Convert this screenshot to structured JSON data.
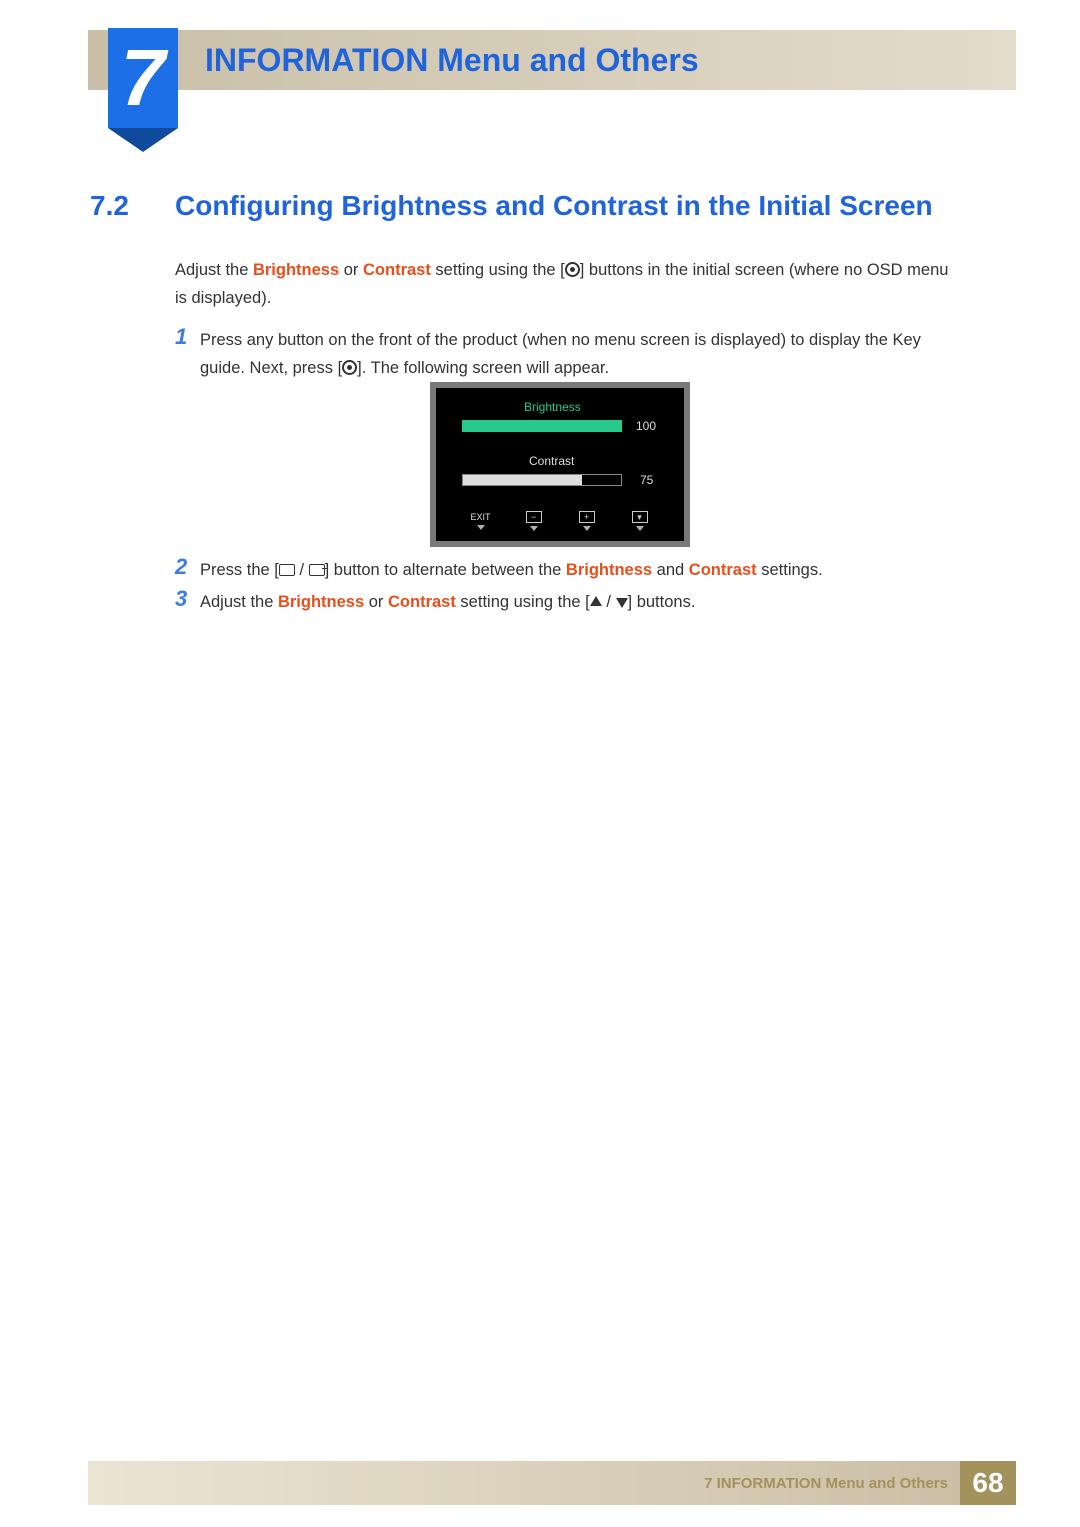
{
  "chapter": {
    "number": "7",
    "title": "INFORMATION Menu and Others"
  },
  "section": {
    "number": "7.2",
    "title": "Configuring Brightness and Contrast in the Initial Screen"
  },
  "intro": {
    "p1a": "Adjust the ",
    "p1b": "Brightness",
    "p1c": " or ",
    "p1d": "Contrast",
    "p1e": " setting using the [",
    "p1f": "] buttons in the initial screen (where no OSD menu is displayed)."
  },
  "steps": {
    "s1": {
      "num": "1",
      "a": "Press any button on the front of the product (when no menu screen is displayed) to display the Key guide. Next, press [",
      "b": "]. The following screen will appear."
    },
    "s2": {
      "num": "2",
      "a": "Press the [",
      "b": "] button to alternate between the ",
      "c": "Brightness",
      "d": " and ",
      "e": "Contrast",
      "f": " settings."
    },
    "s3": {
      "num": "3",
      "a": "Adjust the ",
      "b": "Brightness",
      "c": " or ",
      "d": "Contrast",
      "e": " setting using the [",
      "f": "] buttons."
    }
  },
  "osd": {
    "brightness_label": "Brightness",
    "brightness_value": "100",
    "contrast_label": "Contrast",
    "contrast_value": "75",
    "exit": "EXIT"
  },
  "footer": {
    "title": "7 INFORMATION Menu and Others",
    "page": "68"
  }
}
